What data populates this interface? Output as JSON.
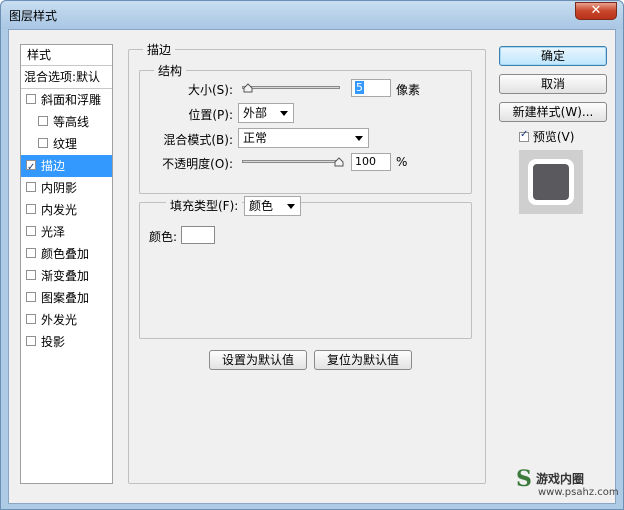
{
  "window": {
    "title": "图层样式",
    "close_glyph": "✕"
  },
  "sidebar": {
    "header": "样式",
    "blend_options": "混合选项:默认",
    "items": [
      {
        "label": "斜面和浮雕",
        "checked": false,
        "sub": false,
        "selected": false
      },
      {
        "label": "等高线",
        "checked": false,
        "sub": true,
        "selected": false
      },
      {
        "label": "纹理",
        "checked": false,
        "sub": true,
        "selected": false
      },
      {
        "label": "描边",
        "checked": true,
        "sub": false,
        "selected": true
      },
      {
        "label": "内阴影",
        "checked": false,
        "sub": false,
        "selected": false
      },
      {
        "label": "内发光",
        "checked": false,
        "sub": false,
        "selected": false
      },
      {
        "label": "光泽",
        "checked": false,
        "sub": false,
        "selected": false
      },
      {
        "label": "颜色叠加",
        "checked": false,
        "sub": false,
        "selected": false
      },
      {
        "label": "渐变叠加",
        "checked": false,
        "sub": false,
        "selected": false
      },
      {
        "label": "图案叠加",
        "checked": false,
        "sub": false,
        "selected": false
      },
      {
        "label": "外发光",
        "checked": false,
        "sub": false,
        "selected": false
      },
      {
        "label": "投影",
        "checked": false,
        "sub": false,
        "selected": false
      }
    ]
  },
  "stroke": {
    "group_title": "描边",
    "structure_title": "结构",
    "size_label": "大小(S):",
    "size_value": "5",
    "size_unit": "像素",
    "position_label": "位置(P):",
    "position_value": "外部",
    "blend_mode_label": "混合模式(B):",
    "blend_mode_value": "正常",
    "opacity_label": "不透明度(O):",
    "opacity_value": "100",
    "opacity_unit": "%",
    "fill_type_label": "填充类型(F):",
    "fill_type_value": "颜色",
    "color_label": "颜色:",
    "color_value": "#ffffff"
  },
  "buttons": {
    "set_default": "设置为默认值",
    "reset_default": "复位为默认值",
    "ok": "确定",
    "cancel": "取消",
    "new_style": "新建样式(W)..."
  },
  "preview": {
    "label": "预览(V)",
    "checked": true
  },
  "watermark": {
    "logo": "S",
    "text": "游戏内圈",
    "url": "www.psahz.com"
  },
  "colors": {
    "selection": "#3399ff",
    "frame": "#aecbe6",
    "preview_square": "#5a5a5e"
  }
}
